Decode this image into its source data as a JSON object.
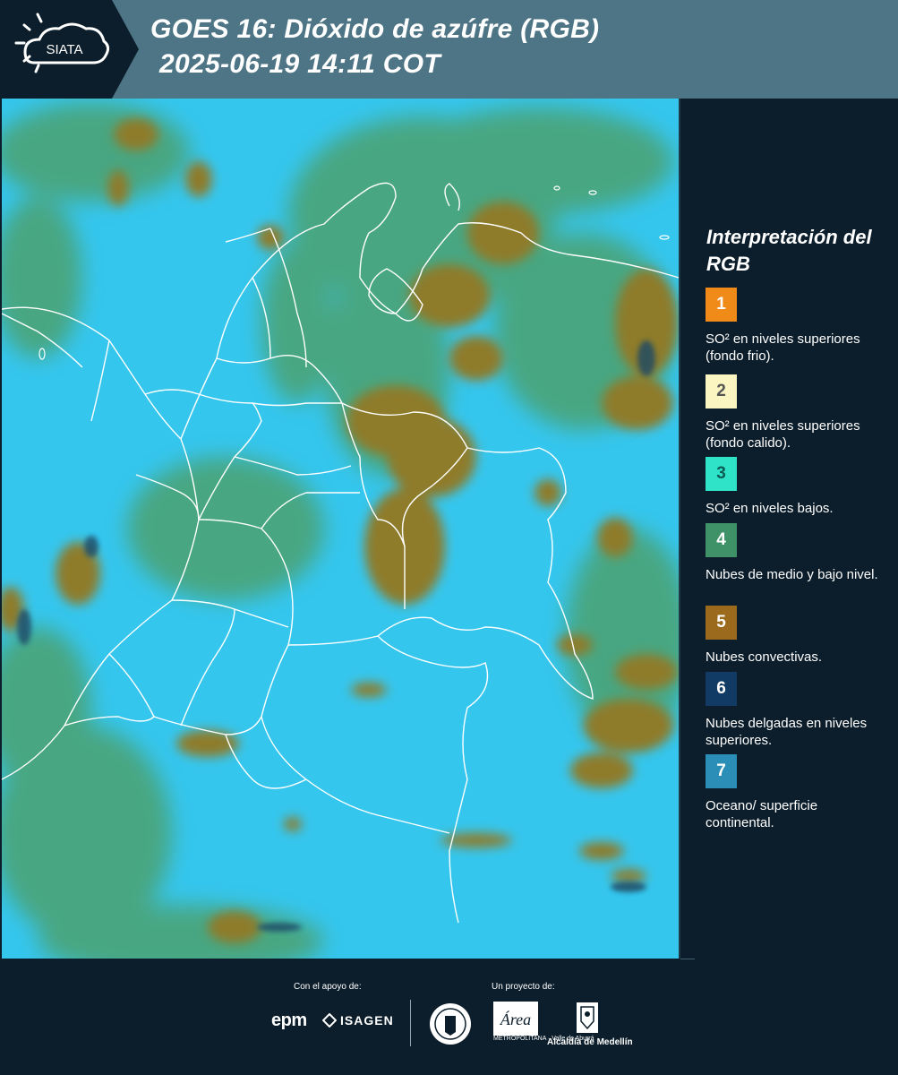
{
  "header": {
    "logo_text": "SIATA",
    "title_line1": "GOES 16: Dióxido de azúfre (RGB)",
    "title_line2": "2025-06-19 14:11 COT"
  },
  "map": {
    "icon": "satellite-rgb-image",
    "colors": {
      "ocean": "#35c6ee",
      "convective": "#8a7a2a",
      "mid_low": "#4d9a5a",
      "boundaries": "#ffffff"
    }
  },
  "legend": {
    "title": "Interpretación del RGB",
    "items": [
      {
        "number": "1",
        "color": "#f08a18",
        "label": "SO² en niveles superiores (fondo frio)."
      },
      {
        "number": "2",
        "color": "#fbf5c2",
        "label": "SO² en niveles superiores (fondo calido)."
      },
      {
        "number": "3",
        "color": "#2ee3c8",
        "label": "SO² en niveles bajos."
      },
      {
        "number": "4",
        "color": "#3f9267",
        "label": "Nubes de medio y bajo nivel."
      },
      {
        "number": "5",
        "color": "#9b6a1c",
        "label": "Nubes convectivas."
      },
      {
        "number": "6",
        "color": "#113a64",
        "label": "Nubes delgadas en niveles superiores."
      },
      {
        "number": "7",
        "color": "#2b8eb6",
        "label": "Oceano/ superficie continental."
      }
    ]
  },
  "footer": {
    "support_label": "Con el apoyo de:",
    "project_label": "Un proyecto de:",
    "sponsor1": "epm",
    "sponsor2": "ISAGEN",
    "area_name": "Área",
    "area_sub": "METROPOLITANA · Valle de Aburrá",
    "alcaldia": "Alcaldía de Medellín"
  }
}
